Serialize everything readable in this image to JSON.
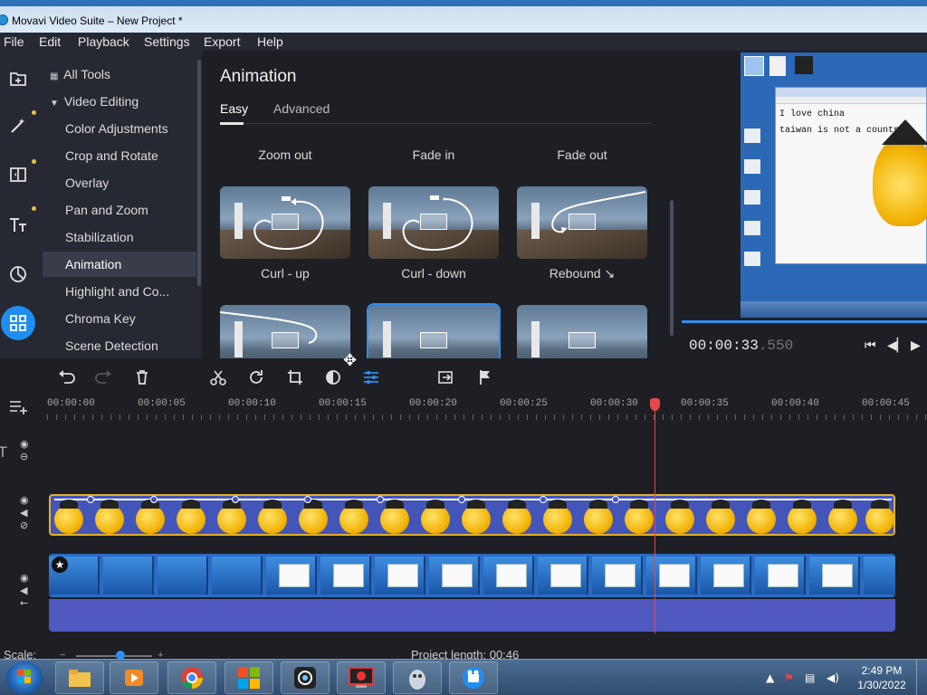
{
  "window": {
    "title": "Movavi Video Suite – New Project *"
  },
  "menu": [
    "File",
    "Edit",
    "Playback",
    "Settings",
    "Export",
    "Help"
  ],
  "rail_icons": [
    "import-icon",
    "magic-wand-icon",
    "transitions-icon",
    "titles-icon",
    "stickers-icon",
    "more-tools-icon"
  ],
  "tools": {
    "items": [
      "All Tools",
      "Video Editing",
      "Color Adjustments",
      "Crop and Rotate",
      "Overlay",
      "Pan and Zoom",
      "Stabilization",
      "Animation",
      "Highlight and Co...",
      "Chroma Key",
      "Scene Detection"
    ],
    "selected": "Animation"
  },
  "animation": {
    "title": "Animation",
    "tabs": [
      "Easy",
      "Advanced"
    ],
    "active_tab": "Easy",
    "row1_captions": [
      "Zoom out",
      "Fade in",
      "Fade out"
    ],
    "row2_captions": [
      "Curl - up",
      "Curl - down",
      "Rebound ↘"
    ]
  },
  "preview": {
    "time_main": "00:00:33",
    "time_ms": ".550",
    "notepad_lines": [
      "I love china",
      "taiwan is not a country"
    ]
  },
  "ruler": [
    "00:00:00",
    "00:00:05",
    "00:00:10",
    "00:00:15",
    "00:00:20",
    "00:00:25",
    "00:00:30",
    "00:00:35",
    "00:00:40",
    "00:00:45"
  ],
  "scale": {
    "label": "Scale:",
    "project_length": "Project length: 00:46"
  },
  "taskbar": {
    "time": "2:49 PM",
    "date": "1/30/2022"
  },
  "colors": {
    "accent": "#1f8ef0",
    "playhead": "#e5484d",
    "overlay_border": "#e2b12a"
  }
}
